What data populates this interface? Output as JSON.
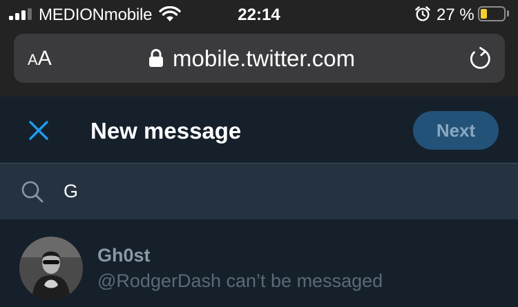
{
  "status_bar": {
    "carrier": "MEDIONmobile",
    "time": "22:14",
    "battery_percent": "27 %",
    "battery_level": 0.27,
    "signal_bars": 4,
    "signal_bars_active": 3
  },
  "browser": {
    "text_size_small": "A",
    "text_size_large": "A",
    "url": "mobile.twitter.com"
  },
  "dm": {
    "title": "New message",
    "next_label": "Next",
    "search_value": "G",
    "results": [
      {
        "name": "Gh0st",
        "status": "@RodgerDash can’t be messaged"
      }
    ]
  },
  "colors": {
    "accent_blue": "#1d9bf0",
    "background": "#15202b",
    "search_bg": "#253341",
    "next_button_disabled": "#235278",
    "battery_yellow": "#f6cf2e"
  },
  "icons": [
    "signal-icon",
    "wifi-icon",
    "alarm-icon",
    "battery-icon",
    "lock-icon",
    "reload-icon",
    "close-icon",
    "search-icon",
    "avatar"
  ]
}
